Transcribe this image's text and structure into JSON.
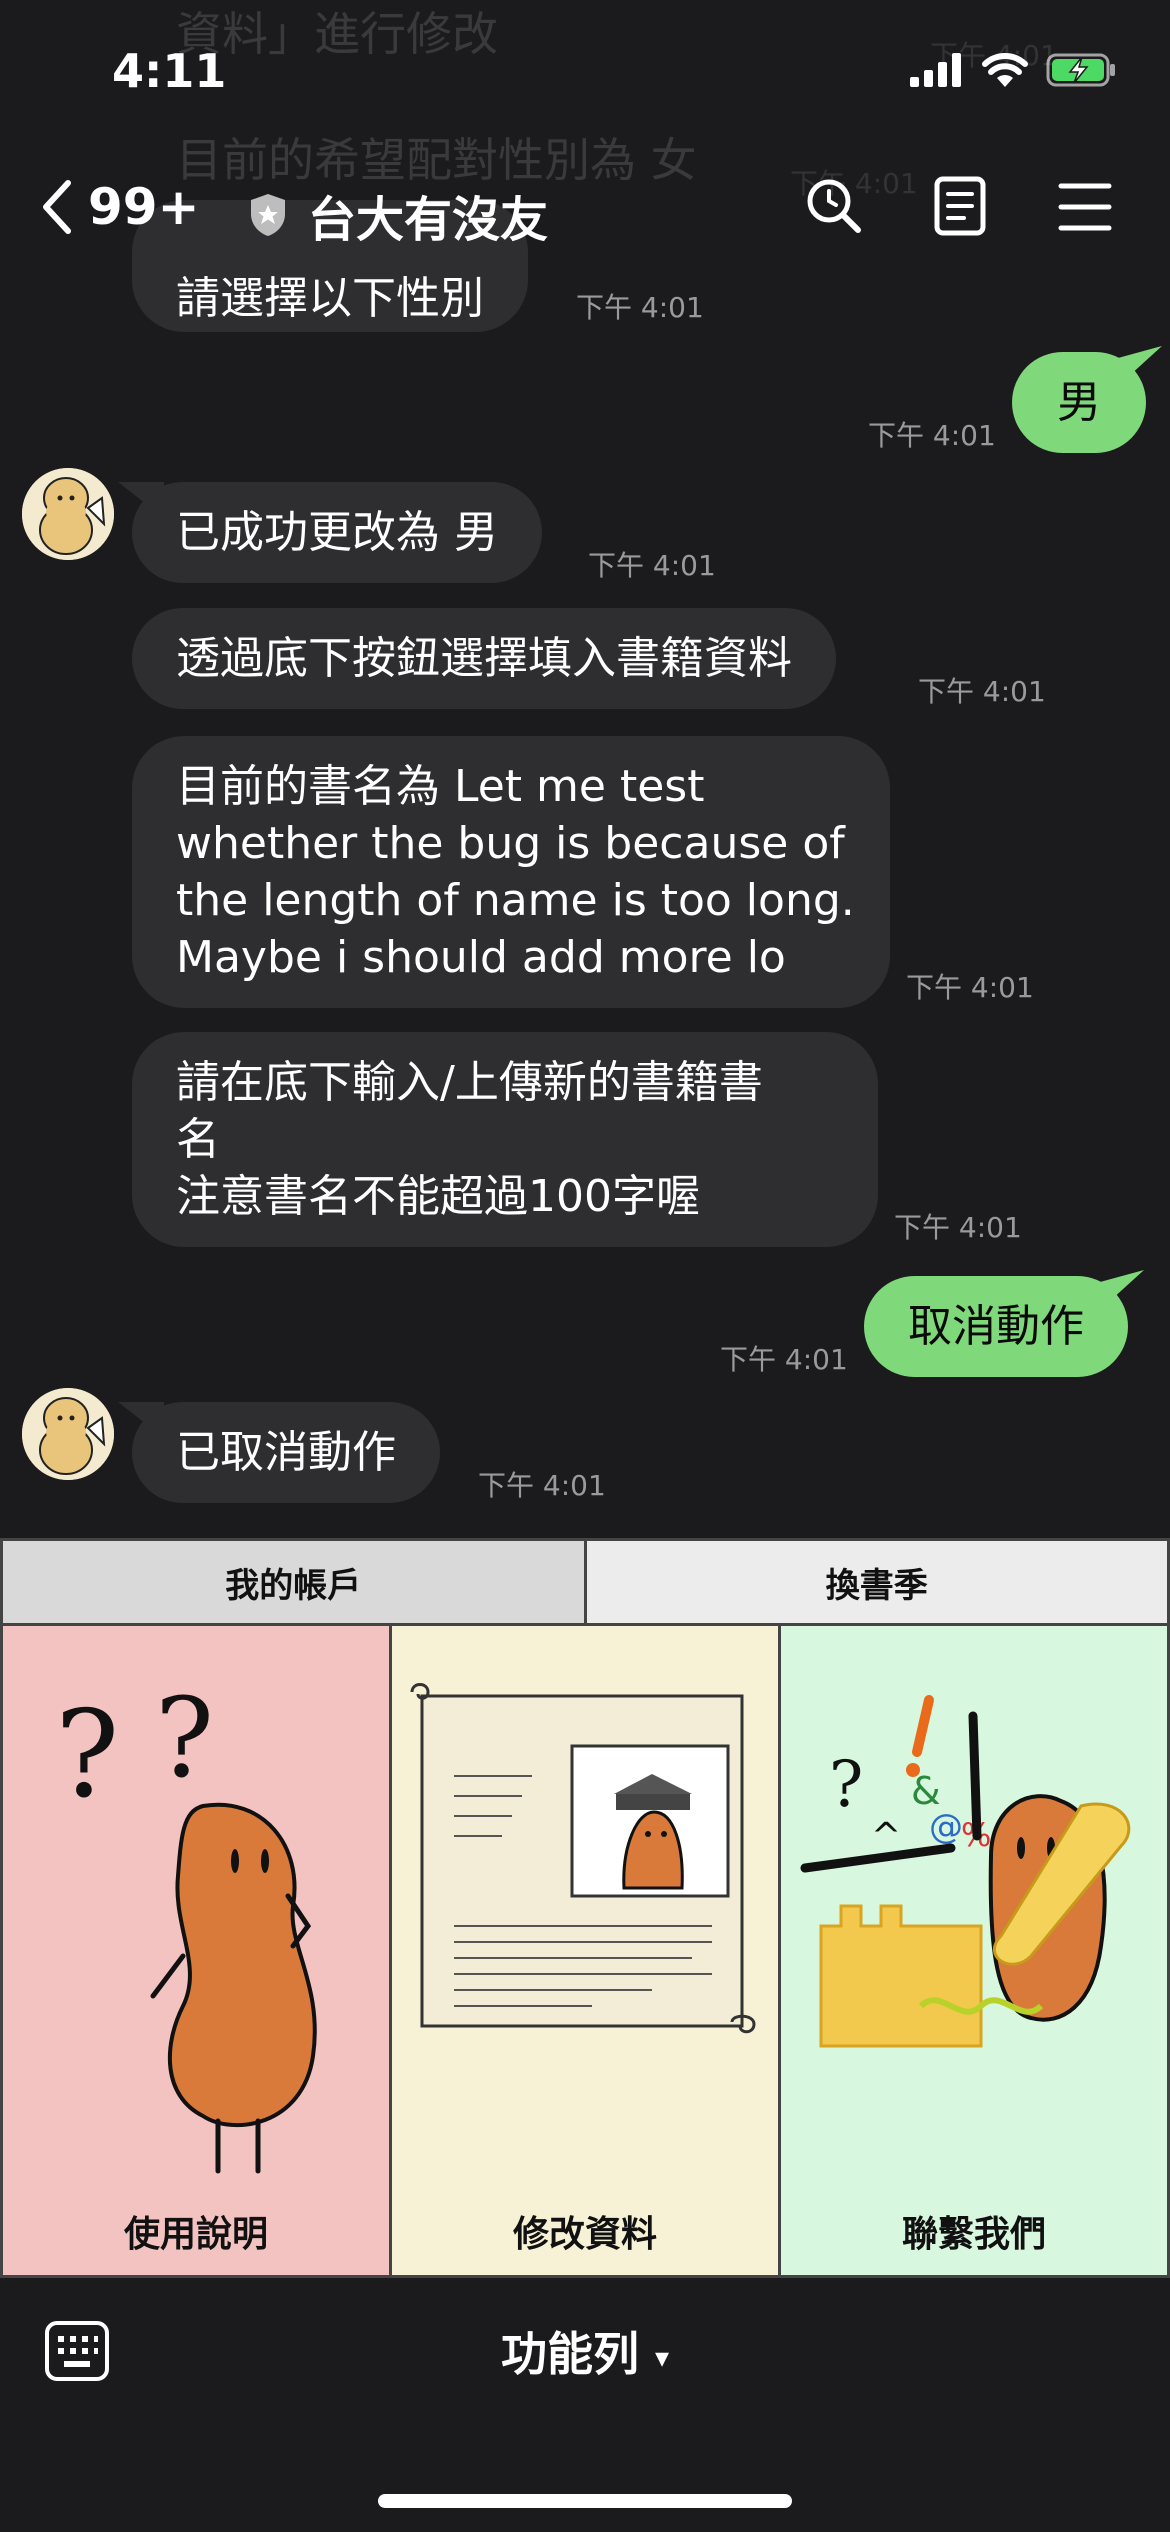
{
  "status_bar": {
    "time": "4:11"
  },
  "ghost": {
    "line1": "資料」進行修改",
    "line2": "目前的希望配對性別為 女",
    "line3": "請選擇以下性別",
    "ts1": "下午 4:01",
    "ts2": "下午 4:01"
  },
  "header": {
    "back_count": "99+",
    "title": "台大有沒友"
  },
  "messages": [
    {
      "side": "left",
      "text": "請選擇以下性別",
      "time": "下午 4:01"
    },
    {
      "side": "right",
      "text": "男",
      "time": "下午 4:01"
    },
    {
      "side": "left",
      "text": "已成功更改為 男",
      "time": "下午 4:01"
    },
    {
      "side": "left",
      "text": "透過底下按鈕選擇填入書籍資料",
      "time": "下午 4:01"
    },
    {
      "side": "left",
      "lines": [
        "目前的書名為 Let me test",
        "whether the bug is because of",
        "the length of name is too long.",
        "Maybe i should add more lo"
      ],
      "time": "下午 4:01"
    },
    {
      "side": "left",
      "lines": [
        "請在底下輸入/上傳新的書籍書",
        "名",
        "注意書名不能超過100字喔"
      ],
      "time": "下午 4:01"
    },
    {
      "side": "right",
      "text": "取消動作",
      "time": "下午 4:01"
    },
    {
      "side": "left",
      "text": "已取消動作",
      "time": "下午 4:01"
    }
  ],
  "rich_menu": {
    "tabs": [
      {
        "label": "我的帳戶"
      },
      {
        "label": "換書季"
      }
    ],
    "panels": [
      {
        "label": "使用說明"
      },
      {
        "label": "修改資料"
      },
      {
        "label": "聯繫我們"
      }
    ]
  },
  "bottom_bar": {
    "label": "功能列",
    "caret": "▾"
  },
  "colors": {
    "background": "#1b1b1d",
    "bubble_other": "#2e2e30",
    "bubble_me": "#7fd87a"
  }
}
